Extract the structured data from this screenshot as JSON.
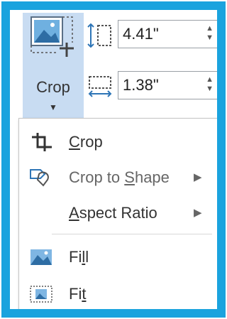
{
  "ribbon": {
    "crop_label": "Crop",
    "caret": "▼",
    "height_value": "4.41\"",
    "width_value": "1.38\"",
    "spin_up": "▲",
    "spin_down": "▼"
  },
  "menu": {
    "items": [
      {
        "label": "Crop",
        "mnemonic": "C",
        "rest": "rop",
        "icon": "crop-icon"
      },
      {
        "label": "Crop to Shape",
        "before": "Crop to ",
        "mnemonic": "S",
        "rest": "hape",
        "arrow": "▶",
        "icon": "crop-to-shape-icon"
      },
      {
        "label": "Aspect Ratio",
        "mnemonic": "A",
        "rest": "spect Ratio",
        "arrow": "▶"
      },
      {
        "label": "Fill",
        "before": "Fi",
        "mnemonic": "l",
        "rest": "l",
        "icon": "fill-icon"
      },
      {
        "label": "Fit",
        "before": "Fi",
        "mnemonic": "t",
        "rest": "",
        "icon": "fit-icon"
      }
    ]
  },
  "colors": {
    "frame": "#1aa3de",
    "button_highlight": "#c8dcf2"
  }
}
